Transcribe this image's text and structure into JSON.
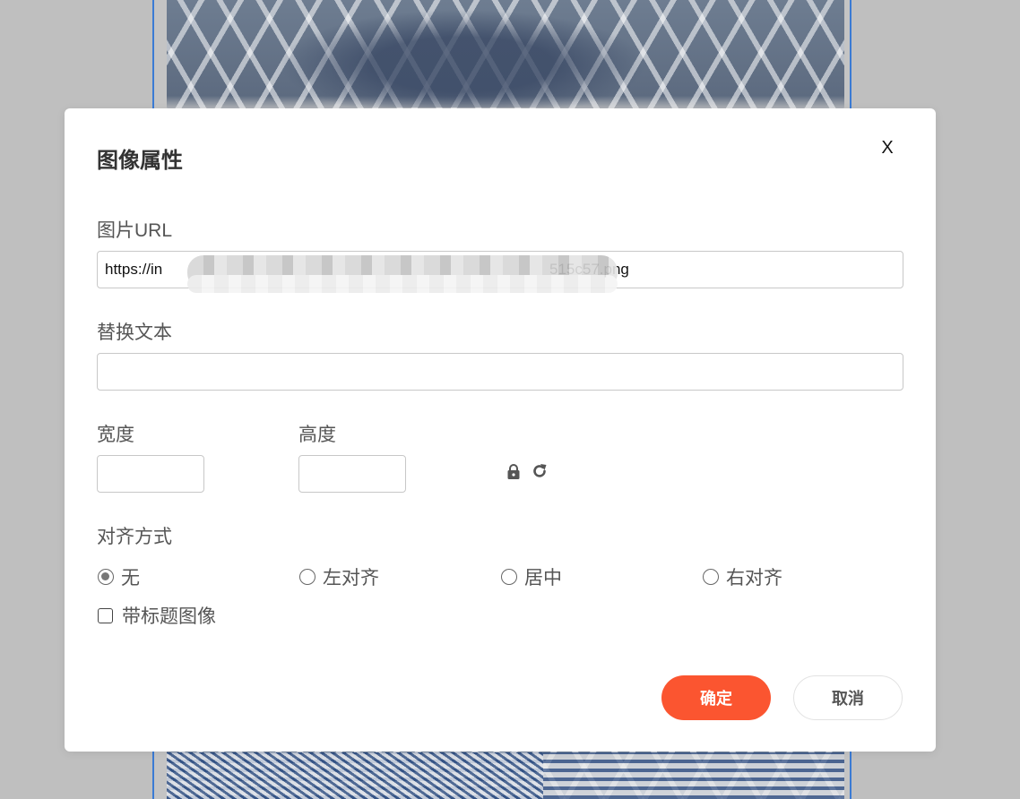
{
  "dialog": {
    "title": "图像属性",
    "close_label": "X"
  },
  "form": {
    "url_label": "图片URL",
    "url_value": "https://in… 515c57.png",
    "url_visible_start": "https://in",
    "url_visible_end": "515c57.png",
    "alt_label": "替换文本",
    "alt_value": "",
    "width_label": "宽度",
    "width_value": "",
    "height_label": "高度",
    "height_value": "",
    "align_label": "对齐方式",
    "align_options": [
      {
        "label": "无",
        "checked": true
      },
      {
        "label": "左对齐",
        "checked": false
      },
      {
        "label": "居中",
        "checked": false
      },
      {
        "label": "右对齐",
        "checked": false
      }
    ],
    "caption_label": "带标题图像",
    "caption_checked": false
  },
  "icons": {
    "lock": "lock-icon",
    "reset": "refresh-icon"
  },
  "buttons": {
    "confirm_label": "确定",
    "cancel_label": "取消"
  },
  "colors": {
    "primary": "#fb5530",
    "overlay": "#bfbfbf",
    "editor_border": "#3b7bd4"
  }
}
